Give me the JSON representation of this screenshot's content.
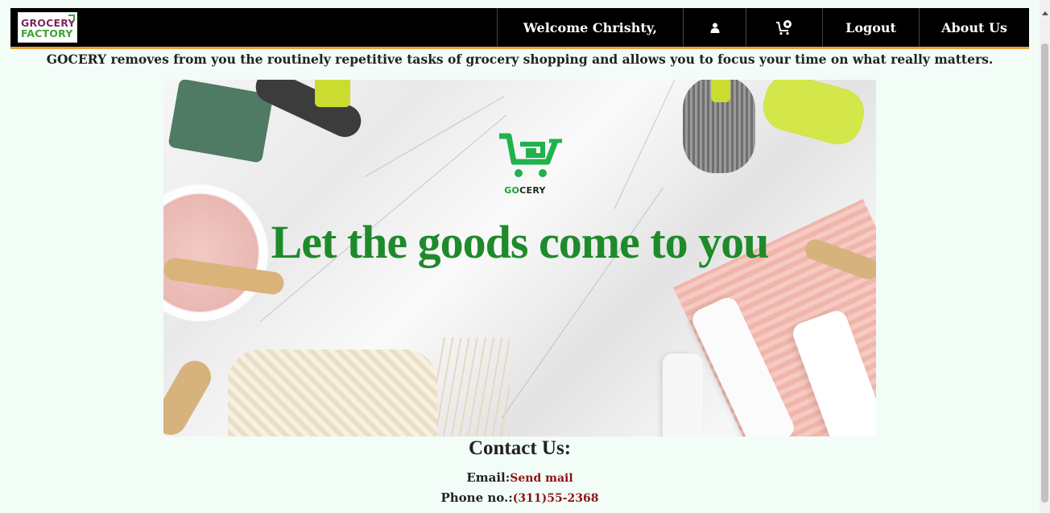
{
  "navbar": {
    "logo_line1": "GROCERY",
    "logo_line2": "FACTORY",
    "welcome": "Welcome Chrishty,",
    "user_icon": "user-icon",
    "cart_icon": "cart-icon",
    "logout": "Logout",
    "about": "About Us"
  },
  "tagline": "GOCERY removes from you the routinely repetitive tasks of grocery shopping and allows you to focus your time on what really matters.",
  "banner": {
    "brand_go": "GO",
    "brand_rest": "CERY",
    "headline": "Let the goods come to you"
  },
  "contact": {
    "title": "Contact Us:",
    "email_label": "Email:",
    "email_link": "Send mail",
    "phone_label": "Phone no.:",
    "phone_value": "(311)55-2368"
  },
  "colors": {
    "navbar_bg": "#000000",
    "navbar_accent": "#e8a33a",
    "page_bg": "#f3fdf8",
    "brand_green": "#1f8a2b",
    "link_red": "#8b1414"
  }
}
